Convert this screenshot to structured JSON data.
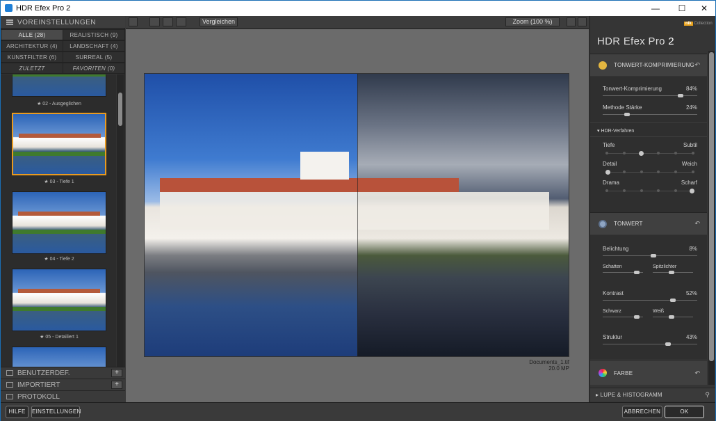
{
  "window": {
    "title": "HDR Efex Pro 2",
    "minimize": "—",
    "maximize": "☐",
    "close": "✕"
  },
  "left_panel": {
    "header": "VOREINSTELLUNGEN",
    "categories": [
      {
        "label": "ALLE (28)"
      },
      {
        "label": "REALISTISCH (9)"
      },
      {
        "label": "ARCHITEKTUR (4)"
      },
      {
        "label": "LANDSCHAFT (4)"
      },
      {
        "label": "KUNSTFILTER (6)"
      },
      {
        "label": "SURREAL (5)"
      },
      {
        "label": "ZULETZT VERWENDET"
      },
      {
        "label": "FAVORITEN (0)"
      }
    ],
    "presets": [
      {
        "label": "★ 02 - Ausgeglichen"
      },
      {
        "label": "★ 03 - Tiefe 1"
      },
      {
        "label": "★ 04 - Tiefe 2"
      },
      {
        "label": "★ 05 - Detailiert 1"
      }
    ],
    "sections": [
      {
        "label": "BENUTZERDEF.",
        "action": "+"
      },
      {
        "label": "IMPORTIERT",
        "action": "+"
      },
      {
        "label": "PROTOKOLL"
      }
    ]
  },
  "toolbar": {
    "compare_label": "Vergleichen",
    "zoom_label": "Zoom (100 %)"
  },
  "canvas": {
    "file_name": "Documents_1.tif",
    "file_size": "20.0 MP"
  },
  "right_panel": {
    "brand": "Collection",
    "brand_badge": "nik",
    "title": "HDR Efex Pro",
    "title_version": "2",
    "sections": {
      "tonwert_kompression": {
        "title": "TONWERT-KOMPRIMIERUNG",
        "sliders": [
          {
            "label": "Tonwert-Komprimierung",
            "value": "84%",
            "level": 0.84
          },
          {
            "label": "Methode Stärke",
            "value": "24%",
            "level": 0.24
          }
        ],
        "hdr_title": "HDR-Verfahren",
        "hdr_rows": [
          {
            "left": "Tiefe",
            "right": "Subtil",
            "selected_index": 2
          },
          {
            "left": "Detail",
            "right": "Weich",
            "selected_index": 0
          },
          {
            "left": "Drama",
            "right": "Scharf",
            "selected_index": 5
          }
        ]
      },
      "tonwert": {
        "title": "TONWERT",
        "belichtung": {
          "label": "Belichtung",
          "value": "8%",
          "level": 0.54
        },
        "schatten": {
          "label": "Schatten",
          "level": 0.9
        },
        "spitzlichter": {
          "label": "Spitzlichter",
          "level": 0.45
        },
        "kontrast": {
          "label": "Kontrast",
          "value": "52%",
          "level": 0.76
        },
        "schwarz": {
          "label": "Schwarz",
          "level": 0.9
        },
        "weiss": {
          "label": "Weiß",
          "level": 0.45
        },
        "struktur": {
          "label": "Struktur",
          "value": "43%",
          "level": 0.7
        }
      },
      "farbe": {
        "title": "FARBE"
      },
      "lupe": {
        "title": "LUPE & HISTOGRAMM"
      }
    }
  },
  "buttons": {
    "hilfe": "HILFE",
    "einstellungen": "EINSTELLUNGEN",
    "abbrechen": "ABBRECHEN",
    "ok": "OK"
  },
  "colors": {
    "accent": "#e89a20",
    "window_border": "#1a6fb5"
  }
}
